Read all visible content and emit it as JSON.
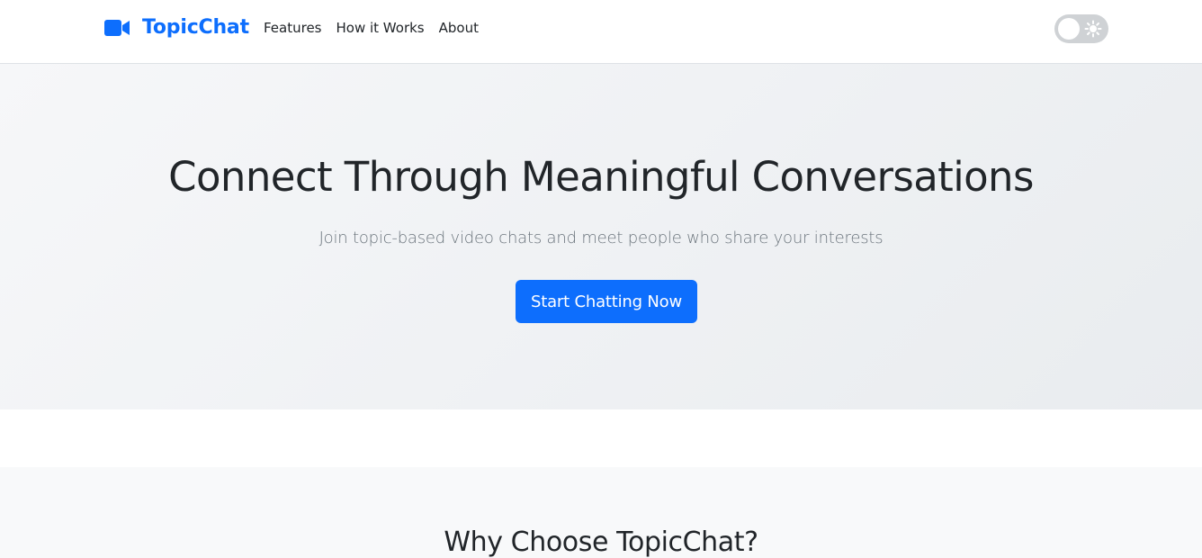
{
  "brand": {
    "name": "TopicChat",
    "icon": "video-camera-icon",
    "color": "#0d6efd"
  },
  "nav": {
    "links": [
      "Features",
      "How it Works",
      "About"
    ]
  },
  "theme_toggle": {
    "icon": "sun-icon",
    "state": "light"
  },
  "hero": {
    "title": "Connect Through Meaningful Conversations",
    "subtitle": "Join topic-based video chats and meet people who share your interests",
    "button_label": "Start Chatting Now"
  },
  "features": {
    "title": "Why Choose TopicChat?"
  },
  "colors": {
    "primary": "#0d6efd",
    "text": "#212529",
    "muted": "#6c757d",
    "hero_bg_start": "#f6f7f9",
    "hero_bg_end": "#e9ecef",
    "section_bg": "#f8f9fa"
  }
}
